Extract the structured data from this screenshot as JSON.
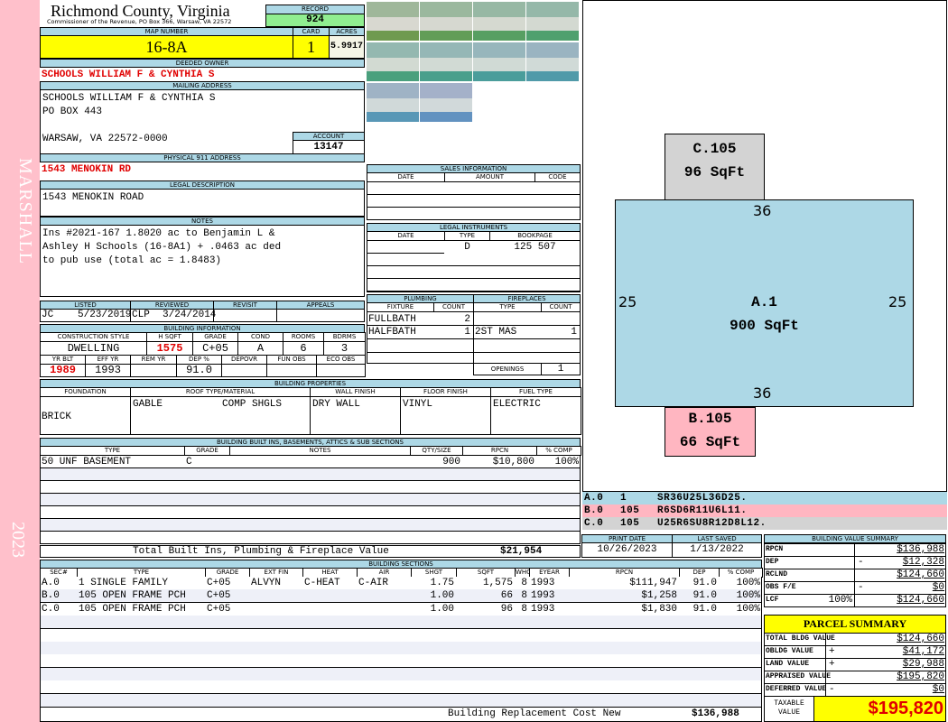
{
  "side": {
    "district": "MARSHALL",
    "year": "2023"
  },
  "header": {
    "county": "Richmond County, Virginia",
    "subtitle": "Commissioner of the Revenue, PO Box 366, Warsaw, VA 22572",
    "record_label": "RECORD",
    "record": "924"
  },
  "map": {
    "map_label": "MAP NUMBER",
    "map_number": "16-8A",
    "card_label": "CARD",
    "card": "1",
    "acres_label": "ACRES",
    "acres": "5.9917"
  },
  "owner": {
    "label": "DEEDED OWNER",
    "value": "SCHOOLS WILLIAM F & CYNTHIA S"
  },
  "mailing": {
    "label": "MAILING ADDRESS",
    "line1": "SCHOOLS WILLIAM F & CYNTHIA S",
    "line2": "PO BOX 443",
    "line3": "WARSAW, VA 22572-0000"
  },
  "account": {
    "label": "ACCOUNT",
    "value": "13147"
  },
  "physical": {
    "label": "PHYSICAL 911 ADDRESS",
    "value": "1543 MENOKIN RD"
  },
  "legal": {
    "label": "LEGAL DESCRIPTION",
    "value": "1543 MENOKIN ROAD"
  },
  "notes": {
    "label": "NOTES",
    "line1": "Ins #2021-167 1.8020 ac to Benjamin L &",
    "line2": "Ashley H Schools (16-8A1) + .0463 ac ded",
    "line3": "to pub use (total ac = 1.8483)"
  },
  "review": {
    "listed_label": "LISTED",
    "listed_by": "JC",
    "listed_date": "5/23/2019",
    "reviewed_label": "REVIEWED",
    "reviewed_by": "CLP",
    "reviewed_date": "3/24/2014",
    "revisit_label": "REVISIT",
    "appeals_label": "APPEALS"
  },
  "bldg": {
    "label": "BUILDING INFORMATION",
    "h1": [
      "CONSTRUCTION STYLE",
      "H SQFT",
      "GRADE",
      "COND",
      "ROOMS",
      "BDRMS"
    ],
    "v1": [
      "DWELLING",
      "1575",
      "C+05",
      "A",
      "6",
      "3"
    ],
    "h2": [
      "YR BLT",
      "EFF YR",
      "REM YR",
      "DEP %",
      "DEPOVR",
      "FUN OBS",
      "ECO OBS"
    ],
    "v2": [
      "1989",
      "1993",
      "",
      "91.0",
      "",
      "",
      ""
    ]
  },
  "sales": {
    "label": "SALES INFORMATION",
    "cols": [
      "DATE",
      "AMOUNT",
      "CODE"
    ]
  },
  "instruments": {
    "label": "LEGAL INSTRUMENTS",
    "cols": [
      "DATE",
      "TYPE",
      "BOOKPAGE"
    ],
    "type": "D",
    "bookpage": "125 507"
  },
  "plumbing": {
    "label": "PLUMBING",
    "cols": [
      "FIXTURE",
      "COUNT"
    ],
    "rows": [
      [
        "FULLBATH",
        "2"
      ],
      [
        "HALFBATH",
        "1"
      ]
    ]
  },
  "fireplaces": {
    "label": "FIREPLACES",
    "cols": [
      "TYPE",
      "COUNT"
    ],
    "type": "2ST MAS",
    "count": "1",
    "openings_label": "OPENINGS",
    "openings": "1"
  },
  "props": {
    "label": "BUILDING PROPERTIES",
    "cols": [
      "FOUNDATION",
      "ROOF TYPE/MATERIAL",
      "WALL FINISH",
      "FLOOR FINISH",
      "FUEL TYPE"
    ],
    "foundation": "BRICK",
    "roof_type": "GABLE",
    "roof_material": "COMP SHGLS",
    "wall": "DRY WALL",
    "floor": "VINYL",
    "fuel": "ELECTRIC"
  },
  "builtins": {
    "label": "BUILDING BUILT INS, BASEMENTS, ATTICS & SUB SECTIONS",
    "cols": [
      "TYPE",
      "GRADE",
      "NOTES",
      "QTY/SIZE",
      "RPCN",
      "% COMP"
    ],
    "rows": [
      [
        "50 UNF BASEMENT",
        "C",
        "",
        "900",
        "$10,800",
        "100%"
      ]
    ],
    "total_label": "Total Built Ins, Plumbing & Fireplace Value",
    "total": "$21,954"
  },
  "dates": {
    "print_label": "PRINT DATE",
    "print": "10/26/2023",
    "saved_label": "LAST SAVED",
    "saved": "1/13/2022"
  },
  "sections": {
    "label": "BUILDING SECTIONS",
    "cols": [
      "SEC#",
      "TYPE",
      "GRADE",
      "EXT FIN",
      "HEAT",
      "AIR",
      "SHGT",
      "SQFT",
      "WHGT",
      "EYEAR",
      "RPCN",
      "DEP",
      "% COMP"
    ],
    "rows": [
      [
        "A.0",
        "1 SINGLE FAMILY",
        "C+05",
        "ALVYN",
        "C-HEAT",
        "C-AIR",
        "1.75",
        "1,575",
        "8",
        "1993",
        "$111,947",
        "91.0",
        "100%"
      ],
      [
        "B.0",
        "105 OPEN FRAME PCH",
        "C+05",
        "",
        "",
        "",
        "1.00",
        "66",
        "8",
        "1993",
        "$1,258",
        "91.0",
        "100%"
      ],
      [
        "C.0",
        "105 OPEN FRAME PCH",
        "C+05",
        "",
        "",
        "",
        "1.00",
        "96",
        "8",
        "1993",
        "$1,830",
        "91.0",
        "100%"
      ]
    ],
    "total_label": "Building Replacement Cost New",
    "total": "$136,988"
  },
  "sketch": {
    "c_label": "C.105",
    "c_area": "96 SqFt",
    "a_label": "A.1",
    "a_area": "900 SqFt",
    "b_label": "B.105",
    "b_area": "66 SqFt",
    "dim_top": "36",
    "dim_bottom": "36",
    "dim_left": "25",
    "dim_right": "25",
    "colors": {
      "a": "#add8e6",
      "b": "#ffb6c1",
      "c": "#d3d3d3"
    },
    "legend": [
      [
        "A.0",
        "1",
        "SR36U25L36D25."
      ],
      [
        "B.0",
        "105",
        "R6SD6R11U6L11."
      ],
      [
        "C.0",
        "105",
        "U25R6SU8R12D8L12."
      ]
    ]
  },
  "summary": {
    "label": "BUILDING VALUE SUMMARY",
    "rows": [
      [
        "RPCN",
        "",
        "",
        "$136,988"
      ],
      [
        "DEP",
        "",
        "-",
        "$12,328"
      ],
      [
        "RCLND",
        "",
        "",
        "$124,660"
      ],
      [
        "OBS F/E",
        "",
        "-",
        "$0"
      ],
      [
        "LCF",
        "100%",
        "",
        "$124,660"
      ]
    ]
  },
  "parcel": {
    "label": "PARCEL SUMMARY",
    "rows": [
      [
        "TOTAL BLDG VALUE",
        "",
        "$124,660"
      ],
      [
        "OBLDG VALUE",
        "+",
        "$41,172"
      ],
      [
        "LAND VALUE",
        "+",
        "$29,988"
      ],
      [
        "APPRAISED VALUE",
        "",
        "$195,820"
      ],
      [
        "DEFERRED VALUE",
        "-",
        "$0"
      ]
    ],
    "taxable_label": "TAXABLE VALUE",
    "taxable": "$195,820"
  }
}
